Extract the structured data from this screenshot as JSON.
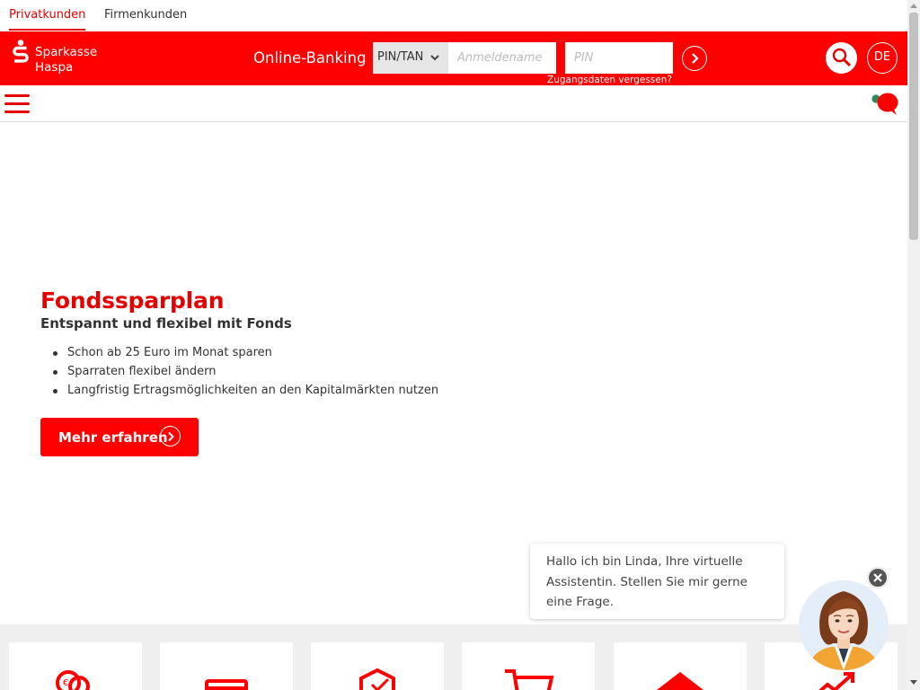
{
  "segments": {
    "privat": "Privatkunden",
    "firmen": "Firmenkunden"
  },
  "brand": {
    "line1": "Sparkasse",
    "line2": "Haspa",
    "primary_color": "#ff0000",
    "text_red": "#e60000"
  },
  "login": {
    "label": "Online-Banking",
    "method": "PIN/TAN",
    "username_placeholder": "Anmeldename",
    "pin_placeholder": "PIN",
    "forgot": "Zugangsdaten vergessen?"
  },
  "header": {
    "language": "DE"
  },
  "hero": {
    "title": "Fondssparplan",
    "subtitle": "Entspannt und flexibel mit Fonds",
    "bullets": [
      "Schon ab 25 Euro im Monat sparen",
      "Sparraten flexibel ändern",
      "Langfristig Ertragsmöglichkeiten an den Kapitalmärkten nutzen"
    ],
    "cta": "Mehr erfahren"
  },
  "tiles": [
    {
      "icon": "coins-icon"
    },
    {
      "icon": "card-icon"
    },
    {
      "icon": "shield-icon"
    },
    {
      "icon": "cart-icon"
    },
    {
      "icon": "house-icon"
    },
    {
      "icon": "growth-arrow-icon"
    }
  ],
  "assistant": {
    "line1": "Hallo ich bin Linda, Ihre virtuelle",
    "line2": "Assistentin. Stellen Sie mir gerne",
    "line3": "eine Frage."
  }
}
